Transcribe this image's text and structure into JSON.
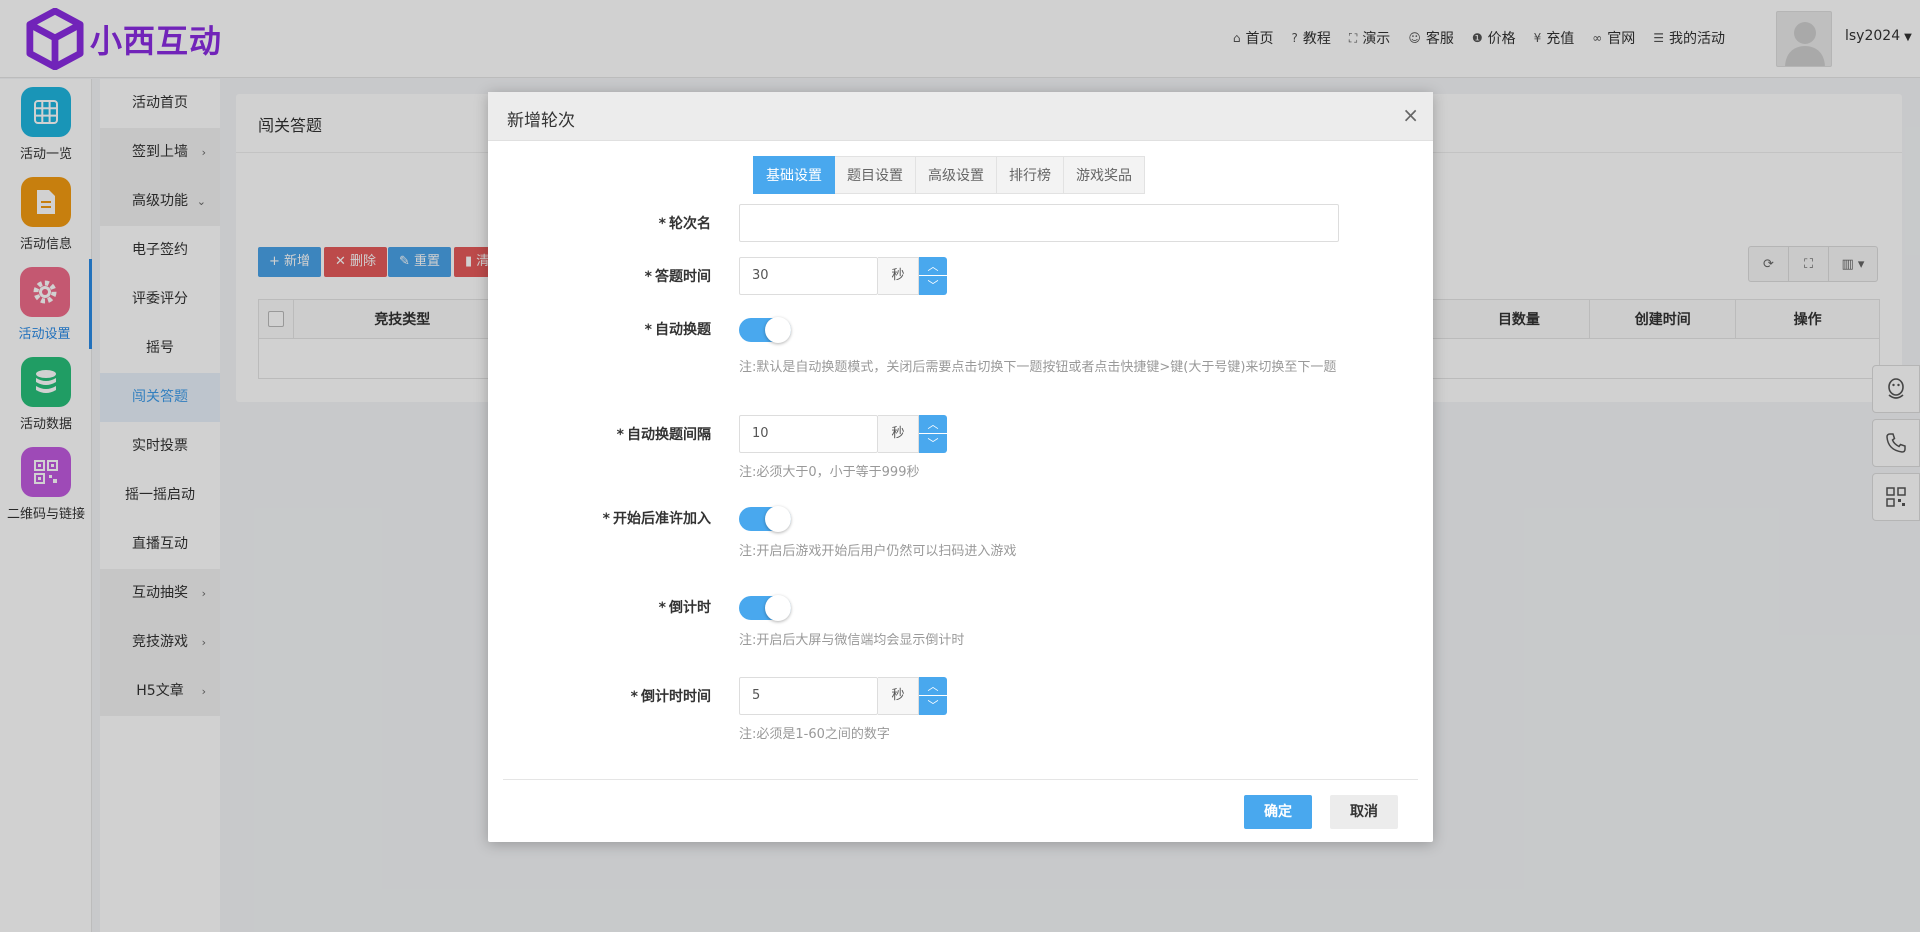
{
  "brand": {
    "name": "小西互动",
    "color": "#8a2be2"
  },
  "topnav": [
    {
      "icon": "home-icon",
      "glyph": "⌂",
      "label": "首页"
    },
    {
      "icon": "help-icon",
      "glyph": "?",
      "label": "教程"
    },
    {
      "icon": "expand-icon",
      "glyph": "⛶",
      "label": "演示"
    },
    {
      "icon": "smile-icon",
      "glyph": "☺",
      "label": "客服"
    },
    {
      "icon": "info-icon",
      "glyph": "❶",
      "label": "价格"
    },
    {
      "icon": "yen-icon",
      "glyph": "¥",
      "label": "充值"
    },
    {
      "icon": "link-icon",
      "glyph": "∞",
      "label": "官网"
    },
    {
      "icon": "list-icon",
      "glyph": "☰",
      "label": "我的活动"
    }
  ],
  "user": {
    "name": "lsy2024"
  },
  "icon_sidebar": [
    {
      "label": "活动一览",
      "icon": "grid-icon",
      "color": "#1fb6e0"
    },
    {
      "label": "活动信息",
      "icon": "document-icon",
      "color": "#f39c12"
    },
    {
      "label": "活动设置",
      "icon": "gear-icon",
      "color": "#f06c8a",
      "active": true
    },
    {
      "label": "活动数据",
      "icon": "database-icon",
      "color": "#28c07a"
    },
    {
      "label": "二维码与链接",
      "icon": "qrcode-icon",
      "color": "#c15be0"
    }
  ],
  "sub_sidebar": [
    {
      "label": "活动首页",
      "arrow": ""
    },
    {
      "label": "签到上墙",
      "arrow": "›",
      "gray": true
    },
    {
      "label": "高级功能",
      "arrow": "⌄",
      "gray": true
    },
    {
      "label": "电子签约",
      "arrow": ""
    },
    {
      "label": "评委评分",
      "arrow": ""
    },
    {
      "label": "摇号",
      "arrow": ""
    },
    {
      "label": "闯关答题",
      "arrow": "",
      "active": true
    },
    {
      "label": "实时投票",
      "arrow": ""
    },
    {
      "label": "摇一摇启动",
      "arrow": ""
    },
    {
      "label": "直播互动",
      "arrow": ""
    },
    {
      "label": "互动抽奖",
      "arrow": "›",
      "gray": true
    },
    {
      "label": "竞技游戏",
      "arrow": "›",
      "gray": true
    },
    {
      "label": "H5文章",
      "arrow": "›",
      "gray": true
    }
  ],
  "card": {
    "title": "闯关答题",
    "toolbar": {
      "add": "+ 新增",
      "delete": "✕ 删除",
      "reset": "✎ 重置",
      "clear": "▮ 清"
    },
    "columns": [
      "竞技类型",
      "目数量",
      "创建时间",
      "操作"
    ]
  },
  "modal": {
    "title": "新增轮次",
    "close": "×",
    "tabs": [
      "基础设置",
      "题目设置",
      "高级设置",
      "排行榜",
      "游戏奖品"
    ],
    "fields": {
      "round_name": {
        "label": "轮次名",
        "value": ""
      },
      "answer_time": {
        "label": "答题时间",
        "value": "30",
        "unit": "秒"
      },
      "auto_switch": {
        "label": "自动换题",
        "on": true,
        "note": "注:默认是自动换题模式，关闭后需要点击切换下一题按钮或者点击快捷键>键(大于号键)来切换至下一题"
      },
      "switch_interval": {
        "label": "自动换题间隔",
        "value": "10",
        "unit": "秒",
        "note": "注:必须大于0，小于等于999秒"
      },
      "allow_join": {
        "label": "开始后准许加入",
        "on": true,
        "note": "注:开启后游戏开始后用户仍然可以扫码进入游戏"
      },
      "countdown": {
        "label": "倒计时",
        "on": true,
        "note": "注:开启后大屏与微信端均会显示倒计时"
      },
      "countdown_time": {
        "label": "倒计时时间",
        "value": "5",
        "unit": "秒",
        "note": "注:必须是1-60之间的数字"
      }
    },
    "confirm": "确定",
    "cancel": "取消"
  }
}
